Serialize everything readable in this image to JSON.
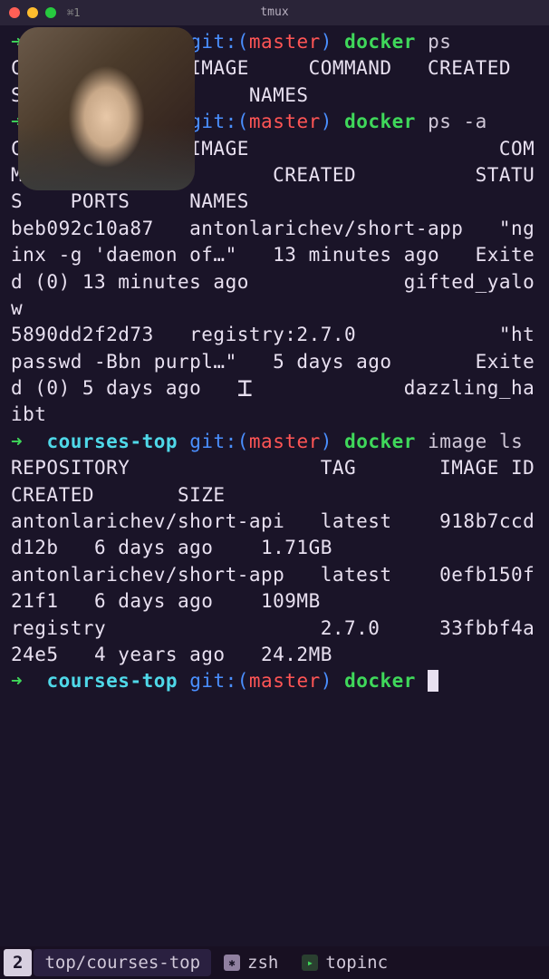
{
  "titlebar": {
    "tab": "⌘1",
    "title": "tmux"
  },
  "terminal": {
    "lines": [
      {
        "type": "prompt",
        "dir_hidden": true,
        "git": "git:",
        "branch": "master",
        "cmd": "docker",
        "args": "ps"
      },
      {
        "type": "out",
        "text": "CONTAINER ID   IMAGE     COMMAND   CREATED   STATUS    PORTS     NAMES"
      },
      {
        "type": "prompt",
        "dir_hidden": true,
        "git": "git:",
        "branch": "master",
        "cmd": "docker",
        "args": "ps -a"
      },
      {
        "type": "out",
        "text": "CONTAINER ID   IMAGE                     COMMAND                  CREATED          STATUS    PORTS     NAMES"
      },
      {
        "type": "out",
        "text": "beb092c10a87   antonlarichev/short-app   \"nginx -g 'daemon of…\"   13 minutes ago   Exited (0) 13 minutes ago             gifted_yalow"
      },
      {
        "type": "out",
        "text": "5890dd2f2d73   registry:2.7.0            \"htpasswd -Bbn purpl…\"   5 days ago       Exited (0) 5 days ago                 dazzling_haibt"
      },
      {
        "type": "prompt",
        "dir": "courses-top",
        "git": "git:",
        "branch": "master",
        "cmd": "docker",
        "args": "image ls"
      },
      {
        "type": "out",
        "text": "REPOSITORY                TAG       IMAGE ID       CREATED       SIZE"
      },
      {
        "type": "out",
        "text": "antonlarichev/short-api   latest    918b7ccdd12b   6 days ago    1.71GB"
      },
      {
        "type": "out",
        "text": "antonlarichev/short-app   latest    0efb150f21f1   6 days ago    109MB"
      },
      {
        "type": "out",
        "text": "registry                  2.7.0     33fbbf4a24e5   4 years ago   24.2MB"
      },
      {
        "type": "prompt",
        "dir": "courses-top",
        "git": "git:",
        "branch": "master",
        "cmd": "docker",
        "args": "",
        "cursor": true
      }
    ]
  },
  "statusbar": {
    "index": "2",
    "seg1": "top/courses-top",
    "seg2": "zsh",
    "seg3": "topinc"
  }
}
